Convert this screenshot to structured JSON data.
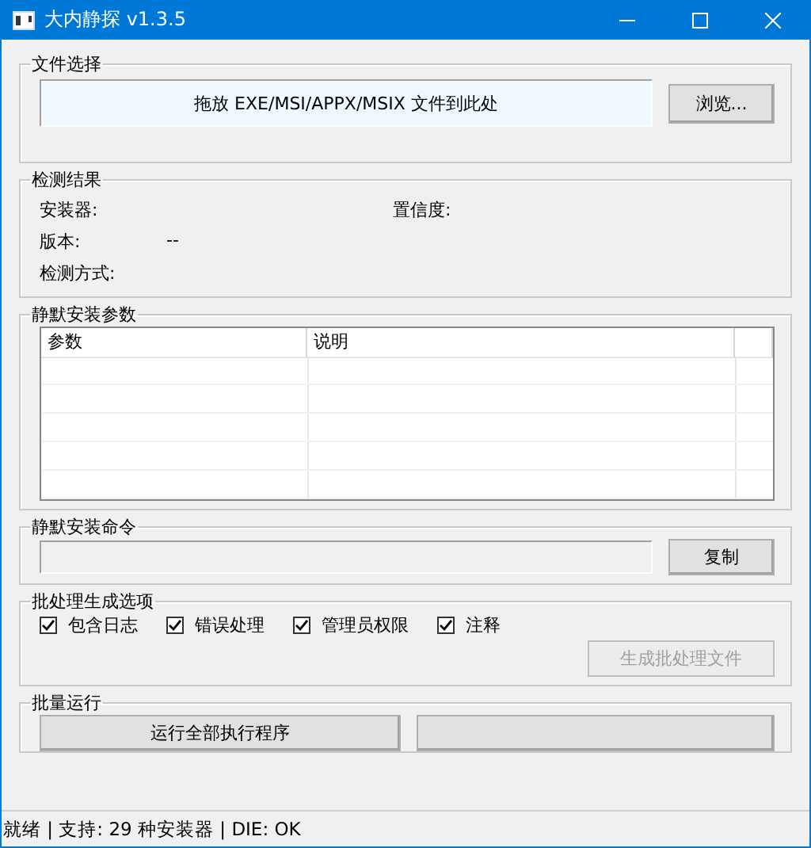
{
  "window": {
    "title": "大内静探 v1.3.5"
  },
  "file_group": {
    "title": "文件选择",
    "drop_zone": "拖放 EXE/MSI/APPX/MSIX 文件到此处",
    "browse_button": "浏览..."
  },
  "result_group": {
    "title": "检测结果",
    "fields": [
      {
        "label": "安装器:"
      },
      {
        "label": "置信度:"
      },
      {
        "label": "版本:",
        "value": "--"
      },
      {
        "label": "检测方式:"
      }
    ]
  },
  "params_group": {
    "title": "静默安装参数",
    "columns": [
      "参数",
      "说明"
    ]
  },
  "command_group": {
    "title": "静默安装命令",
    "copy_button": "复制"
  },
  "batch_group": {
    "title": "批处理生成选项",
    "options": [
      {
        "label": "包含日志",
        "checked": true
      },
      {
        "label": "错误处理",
        "checked": true
      },
      {
        "label": "管理员权限",
        "checked": true
      },
      {
        "label": "注释",
        "checked": true
      }
    ],
    "generate_button": {
      "label": "生成批处理文件",
      "disabled": true
    }
  },
  "run_group": {
    "title": "批量运行",
    "run_all_button": "运行全部执行程序"
  },
  "status_bar": "就绪 | 支持: 29 种安装器 | DIE: OK"
}
